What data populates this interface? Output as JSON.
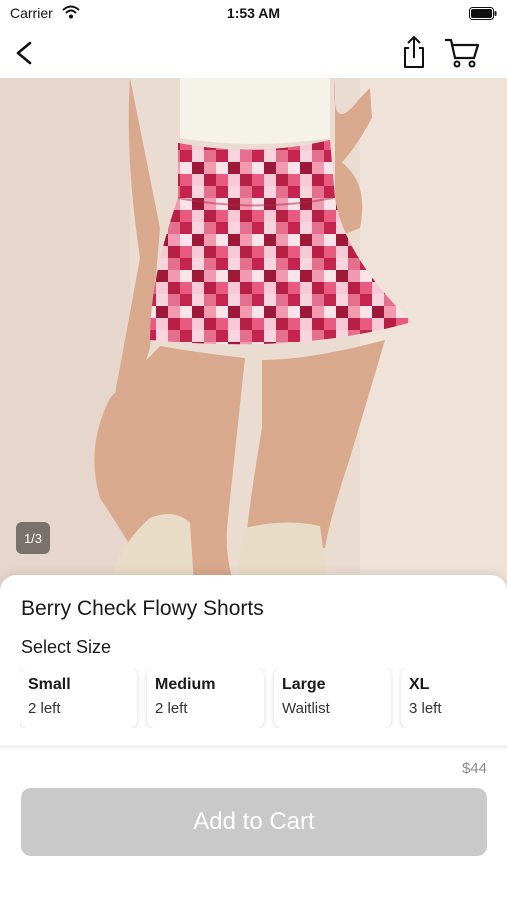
{
  "status_bar": {
    "carrier": "Carrier",
    "time": "1:53 AM"
  },
  "nav": {
    "icons": [
      "chevron-left-icon",
      "share-icon",
      "cart-icon"
    ]
  },
  "gallery": {
    "counter": "1/3"
  },
  "product": {
    "title": "Berry Check Flowy Shorts",
    "select_size_label": "Select Size",
    "sizes": [
      {
        "name": "Small",
        "stock": "2 left"
      },
      {
        "name": "Medium",
        "stock": "2 left"
      },
      {
        "name": "Large",
        "stock": "Waitlist"
      },
      {
        "name": "XL",
        "stock": "3 left"
      }
    ],
    "price": "$44",
    "add_to_cart_label": "Add to Cart"
  },
  "colors": {
    "button_disabled": "#c9c9c9",
    "text": "#1a1a1a",
    "price": "#8a8a8a"
  }
}
